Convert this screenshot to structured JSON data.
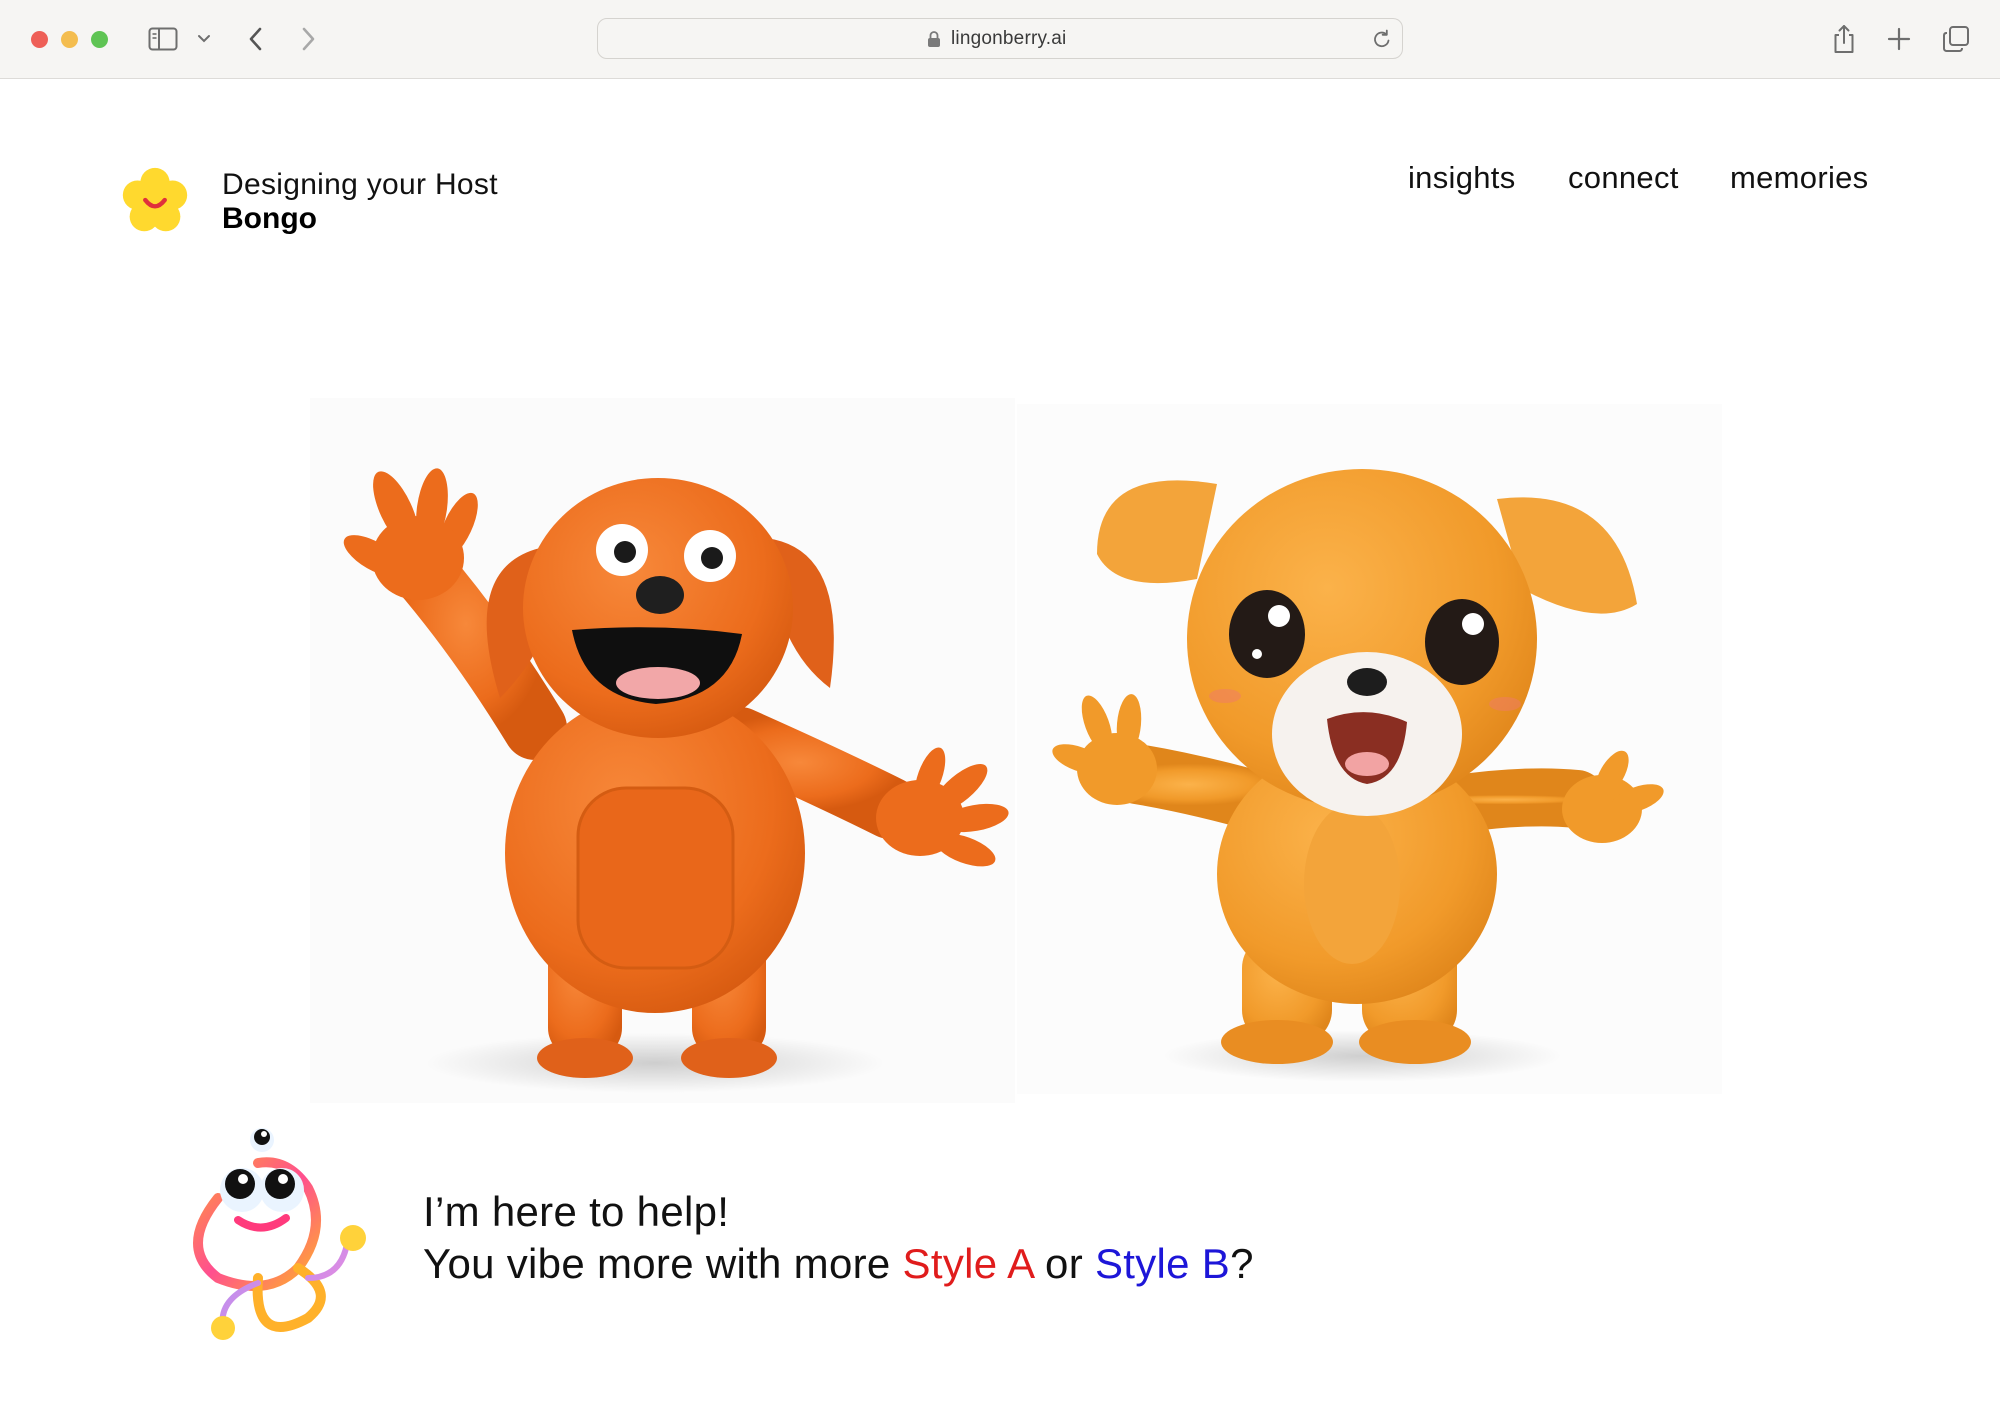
{
  "browser": {
    "url": "lingonberry.ai",
    "icons": [
      "sidebar-icon",
      "chevron-down-icon",
      "back-arrow-icon",
      "forward-arrow-icon",
      "lock-icon",
      "reload-icon",
      "share-icon",
      "plus-icon",
      "tabs-overview-icon"
    ]
  },
  "header": {
    "subtitle": "Designing your Host",
    "host_name": "Bongo",
    "logo_icon": "yellow-flower-smile-icon",
    "logo_color": "#FFD92E"
  },
  "nav": {
    "items": [
      "insights",
      "connect",
      "memories"
    ]
  },
  "options": [
    {
      "label": "Style A",
      "image": "orange-dog-character-waving",
      "color": "#E01C1C"
    },
    {
      "label": "Style B",
      "image": "cute-puppy-character-waving",
      "color": "#1D16D8"
    }
  ],
  "assistant": {
    "mascot_icon": "smiling-squiggle-mascot-icon",
    "line1": "I’m here to help!",
    "line2_prefix": "You vibe more with more ",
    "option_a": "Style A",
    "connector": " or ",
    "option_b": "Style B",
    "suffix": "?"
  }
}
